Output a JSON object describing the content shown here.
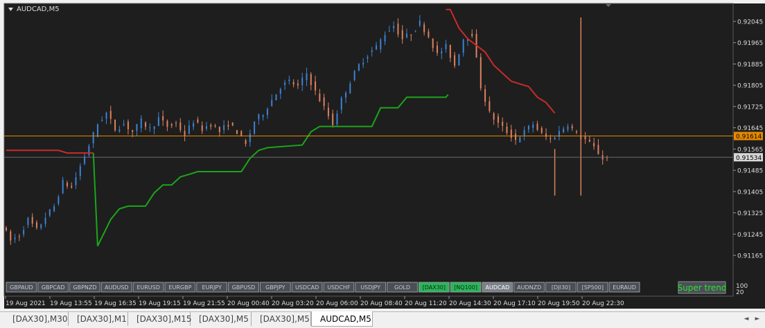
{
  "window": {
    "title": "AUDCAD,M5"
  },
  "colors": {
    "background": "#1e1e1e",
    "bull": "#3b83d6",
    "bear": "#e0815e",
    "trend_up": "#1aa61a",
    "trend_down": "#cc2a2a",
    "bid_line": "#e68a00",
    "ask_line": "#6a6a6a",
    "button_bg": "#4a4f57",
    "button_active": "#2bb55c",
    "button_selected": "#7a8088"
  },
  "price_axis": {
    "labels": [
      "0.92045",
      "0.91965",
      "0.91885",
      "0.91805",
      "0.91725",
      "0.91645",
      "0.91565",
      "0.91485",
      "0.91405",
      "0.91325",
      "0.91245",
      "0.91165"
    ],
    "bid_value": "0.91614",
    "ask_value": "0.91534",
    "ymin": 0.9113,
    "ymax": 0.9209
  },
  "time_axis": {
    "labels": [
      "19 Aug 2021",
      "19 Aug 13:55",
      "19 Aug 16:35",
      "19 Aug 19:15",
      "19 Aug 21:55",
      "20 Aug 00:40",
      "20 Aug 03:20",
      "20 Aug 06:00",
      "20 Aug 08:40",
      "20 Aug 11:20",
      "20 Aug 14:30",
      "20 Aug 17:10",
      "20 Aug 19:50",
      "20 Aug 22:30"
    ]
  },
  "indicator": {
    "name": "Super trend",
    "subwindow_labels": [
      "100",
      "20"
    ]
  },
  "symbol_buttons": [
    {
      "label": "GBPAUD",
      "state": "normal"
    },
    {
      "label": "GBPCAD",
      "state": "normal"
    },
    {
      "label": "GBPNZD",
      "state": "normal"
    },
    {
      "label": "AUDUSD",
      "state": "normal"
    },
    {
      "label": "EURUSD",
      "state": "normal"
    },
    {
      "label": "EURGBP",
      "state": "normal"
    },
    {
      "label": "EURJPY",
      "state": "normal"
    },
    {
      "label": "GBPUSD",
      "state": "normal"
    },
    {
      "label": "GBPJPY",
      "state": "normal"
    },
    {
      "label": "USDCAD",
      "state": "normal"
    },
    {
      "label": "USDCHF",
      "state": "normal"
    },
    {
      "label": "USDJPY",
      "state": "normal"
    },
    {
      "label": "GOLD",
      "state": "normal"
    },
    {
      "label": "[DAX30]",
      "state": "active"
    },
    {
      "label": "[NQ100]",
      "state": "active"
    },
    {
      "label": "AUDCAD",
      "state": "selected"
    },
    {
      "label": "AUDNZD",
      "state": "normal"
    },
    {
      "label": "[DJI30]",
      "state": "normal"
    },
    {
      "label": "[SP500]",
      "state": "normal"
    },
    {
      "label": "EURAUD",
      "state": "normal"
    }
  ],
  "tabs": [
    {
      "label": "[DAX30],M30",
      "active": false
    },
    {
      "label": "[DAX30],M1",
      "active": false
    },
    {
      "label": "[DAX30],M15",
      "active": false
    },
    {
      "label": "[DAX30],M5",
      "active": false
    },
    {
      "label": "[DAX30],M5",
      "active": false
    },
    {
      "label": "AUDCAD,M5",
      "active": true
    }
  ],
  "tab_nav": {
    "left": "◄",
    "right": "►"
  },
  "chart_data": {
    "type": "candlestick",
    "symbol": "AUDCAD",
    "timeframe": "M5",
    "path": [
      [
        0,
        0.9128
      ],
      [
        2,
        0.9122
      ],
      [
        4,
        0.9124
      ],
      [
        6,
        0.913
      ],
      [
        8,
        0.9126
      ],
      [
        10,
        0.9131
      ],
      [
        12,
        0.9135
      ],
      [
        14,
        0.9144
      ],
      [
        16,
        0.9142
      ],
      [
        18,
        0.915
      ],
      [
        20,
        0.9158
      ],
      [
        22,
        0.9166
      ],
      [
        24,
        0.917
      ],
      [
        26,
        0.9164
      ],
      [
        28,
        0.9166
      ],
      [
        30,
        0.9163
      ],
      [
        32,
        0.9167
      ],
      [
        34,
        0.9164
      ],
      [
        36,
        0.9168
      ],
      [
        38,
        0.9165
      ],
      [
        40,
        0.9166
      ],
      [
        42,
        0.9162
      ],
      [
        44,
        0.9167
      ],
      [
        46,
        0.9164
      ],
      [
        48,
        0.9166
      ],
      [
        50,
        0.9163
      ],
      [
        52,
        0.9166
      ],
      [
        54,
        0.9163
      ],
      [
        56,
        0.9158
      ],
      [
        58,
        0.9167
      ],
      [
        60,
        0.917
      ],
      [
        62,
        0.9175
      ],
      [
        64,
        0.918
      ],
      [
        66,
        0.9182
      ],
      [
        68,
        0.918
      ],
      [
        70,
        0.9185
      ],
      [
        72,
        0.9178
      ],
      [
        74,
        0.9172
      ],
      [
        76,
        0.9166
      ],
      [
        78,
        0.9175
      ],
      [
        80,
        0.9182
      ],
      [
        82,
        0.9188
      ],
      [
        84,
        0.9192
      ],
      [
        86,
        0.9195
      ],
      [
        88,
        0.92
      ],
      [
        90,
        0.9203
      ],
      [
        92,
        0.9198
      ],
      [
        94,
        0.92
      ],
      [
        96,
        0.9204
      ],
      [
        98,
        0.9199
      ],
      [
        100,
        0.9192
      ],
      [
        102,
        0.9195
      ],
      [
        104,
        0.9188
      ],
      [
        106,
        0.9198
      ],
      [
        108,
        0.92
      ],
      [
        110,
        0.918
      ],
      [
        112,
        0.917
      ],
      [
        114,
        0.9166
      ],
      [
        116,
        0.9163
      ],
      [
        118,
        0.916
      ],
      [
        120,
        0.9163
      ],
      [
        122,
        0.9166
      ],
      [
        124,
        0.9162
      ],
      [
        126,
        0.916
      ],
      [
        128,
        0.9163
      ],
      [
        130,
        0.9166
      ],
      [
        132,
        0.9162
      ],
      [
        134,
        0.916
      ],
      [
        136,
        0.9157
      ],
      [
        138,
        0.9153
      ]
    ],
    "supertrend_down_1": [
      [
        0,
        0.9156
      ],
      [
        12,
        0.9156
      ],
      [
        14,
        0.9155
      ],
      [
        20,
        0.9155
      ]
    ],
    "supertrend_up": [
      [
        20,
        0.9155
      ],
      [
        21,
        0.912
      ],
      [
        24,
        0.913
      ],
      [
        26,
        0.9134
      ],
      [
        28,
        0.9135
      ],
      [
        32,
        0.9135
      ],
      [
        34,
        0.914
      ],
      [
        36,
        0.9143
      ],
      [
        38,
        0.9143
      ],
      [
        40,
        0.9146
      ],
      [
        42,
        0.9147
      ],
      [
        44,
        0.9148
      ],
      [
        48,
        0.9148
      ],
      [
        54,
        0.9148
      ],
      [
        56,
        0.9153
      ],
      [
        58,
        0.9156
      ],
      [
        60,
        0.9157
      ],
      [
        68,
        0.9158
      ],
      [
        70,
        0.9163
      ],
      [
        72,
        0.9165
      ],
      [
        84,
        0.9165
      ],
      [
        86,
        0.9172
      ],
      [
        90,
        0.9172
      ],
      [
        92,
        0.9176
      ],
      [
        101,
        0.9176
      ],
      [
        101.5,
        0.9177
      ]
    ],
    "supertrend_down_2": [
      [
        101,
        0.9209
      ],
      [
        102,
        0.9209
      ],
      [
        104,
        0.9202
      ],
      [
        106,
        0.9198
      ],
      [
        110,
        0.9193
      ],
      [
        112,
        0.9188
      ],
      [
        114,
        0.9185
      ],
      [
        116,
        0.9182
      ],
      [
        118,
        0.9181
      ],
      [
        120,
        0.918
      ],
      [
        122,
        0.9176
      ],
      [
        124,
        0.9174
      ],
      [
        126,
        0.917
      ]
    ],
    "spikes": [
      [
        126,
        0.91565,
        0.9139
      ],
      [
        132,
        0.9206,
        0.9139
      ]
    ],
    "candle_count": 139
  }
}
